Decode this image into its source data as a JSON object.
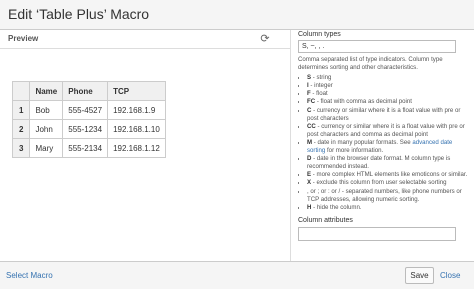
{
  "dialog": {
    "title": "Edit ‘Table Plus’ Macro"
  },
  "preview": {
    "label": "Preview",
    "table": {
      "headers": [
        "",
        "Name",
        "Phone",
        "TCP"
      ],
      "rows": [
        [
          "1",
          "Bob",
          "555-4527",
          "192.168.1.9"
        ],
        [
          "2",
          "John",
          "555-1234",
          "192.168.1.10"
        ],
        [
          "3",
          "Mary",
          "555-2134",
          "192.168.1.12"
        ]
      ]
    }
  },
  "column_types": {
    "label": "Column types",
    "value": "S, ~, , .",
    "description": "Comma separated list of type indicators. Column type determines sorting and other characteristics.",
    "items": [
      {
        "key": "S",
        "text": " - string"
      },
      {
        "key": "I",
        "text": " - integer"
      },
      {
        "key": "F",
        "text": " - float"
      },
      {
        "key": "FC",
        "text": " - float with comma as decimal point"
      },
      {
        "key": "C",
        "text": " - currency or similar where it is a float value with pre or post characters"
      },
      {
        "key": "CC",
        "text": " - currency or similar where it is a float value with pre or post characters and comma as decimal point"
      },
      {
        "key": "M",
        "text": " - date in many popular formats. See ",
        "link": "advanced date sorting",
        "after": " for more information."
      },
      {
        "key": "D",
        "text": " - date in the browser date format. M column type is recommended instead."
      },
      {
        "key": "E",
        "text": " - more complex HTML elements like emoticons or similar."
      },
      {
        "key": "X",
        "text": " - exclude this column from user selectable sorting"
      },
      {
        "key": "",
        "text": ", or ; or : or / - separated numbers, like phone numbers or TCP addresses, allowing numeric sorting."
      },
      {
        "key": "H",
        "text": " - hide the column."
      }
    ]
  },
  "column_attributes": {
    "label": "Column attributes",
    "value": ""
  },
  "footer": {
    "select_macro": "Select Macro",
    "save": "Save",
    "close": "Close"
  }
}
